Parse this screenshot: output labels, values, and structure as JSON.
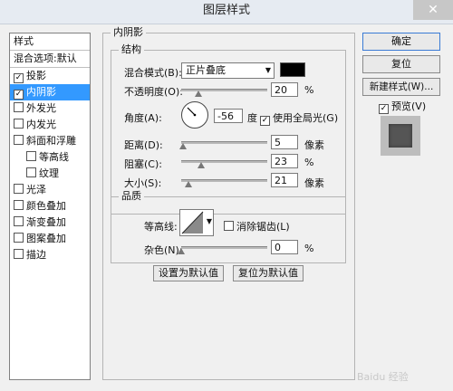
{
  "window": {
    "title": "图层样式",
    "close_glyph": "✕"
  },
  "sidebar": {
    "header": "样式",
    "blend_options": "混合选项:默认",
    "items": [
      {
        "label": "投影",
        "checked": true
      },
      {
        "label": "内阴影",
        "checked": true,
        "selected": true
      },
      {
        "label": "外发光",
        "checked": false
      },
      {
        "label": "内发光",
        "checked": false
      },
      {
        "label": "斜面和浮雕",
        "checked": false
      },
      {
        "label": "等高线",
        "checked": false,
        "indent": true
      },
      {
        "label": "纹理",
        "checked": false,
        "indent": true
      },
      {
        "label": "光泽",
        "checked": false
      },
      {
        "label": "颜色叠加",
        "checked": false
      },
      {
        "label": "渐变叠加",
        "checked": false
      },
      {
        "label": "图案叠加",
        "checked": false
      },
      {
        "label": "描边",
        "checked": false
      }
    ]
  },
  "panel": {
    "title": "内阴影",
    "structure": {
      "title": "结构",
      "blend_mode_label": "混合模式(B):",
      "blend_mode_value": "正片叠底",
      "blend_color": "#000000",
      "opacity_label": "不透明度(O):",
      "opacity_value": "20",
      "opacity_unit": "%",
      "opacity_level": 0.2,
      "angle_label": "角度(A):",
      "angle_value": "-56",
      "angle_unit": "度",
      "global_light_label": "使用全局光(G)",
      "global_light_checked": true,
      "distance_label": "距离(D):",
      "distance_value": "5",
      "distance_unit": "像素",
      "distance_level": 0.02,
      "choke_label": "阻塞(C):",
      "choke_value": "23",
      "choke_unit": "%",
      "choke_level": 0.23,
      "size_label": "大小(S):",
      "size_value": "21",
      "size_unit": "像素",
      "size_level": 0.08
    },
    "quality": {
      "title": "品质",
      "contour_label": "等高线:",
      "antialias_label": "消除锯齿(L)",
      "antialias_checked": false,
      "noise_label": "杂色(N):",
      "noise_value": "0",
      "noise_unit": "%",
      "noise_level": 0
    },
    "make_default": "设置为默认值",
    "reset_default": "复位为默认值"
  },
  "actions": {
    "ok": "确定",
    "reset": "复位",
    "new_style": "新建样式(W)...",
    "preview_label": "预览(V)",
    "preview_checked": true
  },
  "watermark": "Baidu 经验"
}
